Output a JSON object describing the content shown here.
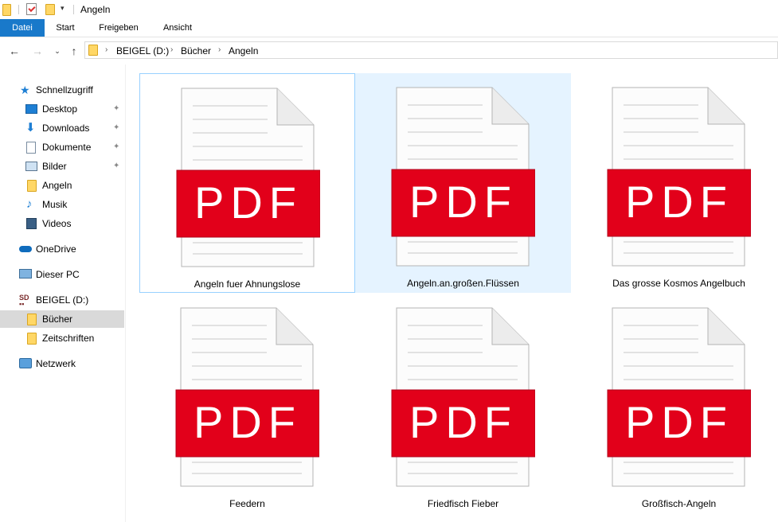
{
  "window": {
    "title": "Angeln"
  },
  "ribbon": {
    "tabs": [
      "Datei",
      "Start",
      "Freigeben",
      "Ansicht"
    ]
  },
  "breadcrumb": [
    "BEIGEL (D:)",
    "Bücher",
    "Angeln"
  ],
  "sidebar": {
    "items": [
      {
        "label": "Schnellzugriff",
        "icon": "star-icon"
      },
      {
        "label": "Desktop",
        "icon": "desktop-icon",
        "pinned": true
      },
      {
        "label": "Downloads",
        "icon": "download-icon",
        "pinned": true
      },
      {
        "label": "Dokumente",
        "icon": "documents-icon",
        "pinned": true
      },
      {
        "label": "Bilder",
        "icon": "pictures-icon",
        "pinned": true
      },
      {
        "label": "Angeln",
        "icon": "folder-icon"
      },
      {
        "label": "Musik",
        "icon": "music-icon"
      },
      {
        "label": "Videos",
        "icon": "video-icon"
      },
      {
        "label": "OneDrive",
        "icon": "cloud-icon"
      },
      {
        "label": "Dieser PC",
        "icon": "computer-icon"
      },
      {
        "label": "BEIGEL (D:)",
        "icon": "drive-icon"
      },
      {
        "label": "Bücher",
        "icon": "folder-icon",
        "selected": true
      },
      {
        "label": "Zeitschriften",
        "icon": "folder-icon"
      },
      {
        "label": "Netzwerk",
        "icon": "network-icon"
      }
    ]
  },
  "files": {
    "pdf_label": "PDF",
    "items": [
      {
        "name": "Angeln fuer Ahnungslose",
        "state": "focused"
      },
      {
        "name": "Angeln.an.großen.Flüssen",
        "state": "hover"
      },
      {
        "name": "Das grosse Kosmos Angelbuch",
        "state": "normal"
      },
      {
        "name": "Feedern",
        "state": "normal"
      },
      {
        "name": "Friedfisch Fieber",
        "state": "normal"
      },
      {
        "name": "Großfisch-Angeln",
        "state": "normal"
      }
    ]
  },
  "colors": {
    "pdf_red": "#e2001a",
    "accent": "#1979ca",
    "hover": "#e5f3ff",
    "selected": "#d9d9d9"
  }
}
